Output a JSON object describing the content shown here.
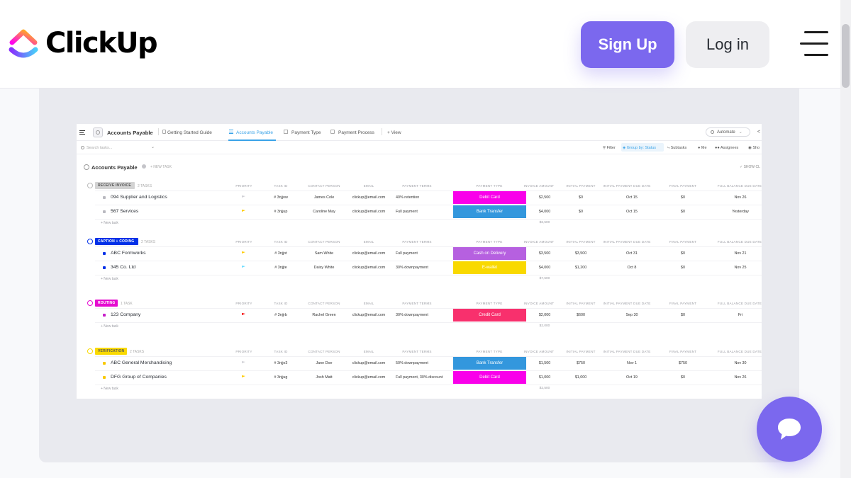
{
  "header": {
    "brand": "ClickUp",
    "signup_label": "Sign Up",
    "login_label": "Log in",
    "menu_icon": "hamburger-menu-icon"
  },
  "screenshot": {
    "list_title": "Accounts Payable",
    "tabs": [
      {
        "label": "Getting Started Guide",
        "active": false
      },
      {
        "label": "Accounts Payable",
        "active": true
      },
      {
        "label": "Payment Type",
        "active": false
      },
      {
        "label": "Payment Process",
        "active": false
      }
    ],
    "add_view": "+ View",
    "automate": "Automate",
    "search_placeholder": "Search tasks...",
    "toolbar": {
      "filter": "Filter",
      "group_by": "Group by: Status",
      "subtasks": "Subtasks",
      "me": "Me",
      "assignees": "Assignees",
      "show": "Sho"
    },
    "section_title": "Accounts Payable",
    "new_task_label": "+ NEW TASK",
    "show_closed": "SHOW CL",
    "columns": [
      "PRIORITY",
      "TASK ID",
      "CONTACT PERSON",
      "EMAIL",
      "PAYMENT TERMS",
      "PAYMENT TYPE",
      "INVOICE AMOUNT",
      "INITIAL PAYMENT",
      "INITIAL PAYMENT DUE DATE",
      "FINAL PAYMENT",
      "FULL BALANCE DUE DATE"
    ],
    "add_task": "+ New task",
    "groups": [
      {
        "status": "RECEIVE INVOICE",
        "count": "2 TASKS",
        "color": "#d3d3d3",
        "text_color": "#555555",
        "total": "$6,500",
        "tasks": [
          {
            "name": "094 Supplier and Logistics",
            "dot": "#b9b9c0",
            "flag": "#d0d0d6",
            "task_id": "# 3njjow",
            "contact": "James Cole",
            "email": "clickup@email.com",
            "terms": "40% retention",
            "type": "Debit Card",
            "type_color": "#f900ea",
            "invoice": "$2,500",
            "initial": "$0",
            "initial_due": "Oct 15",
            "final": "$0",
            "balance_due": "Nov 26"
          },
          {
            "name": "567 Services",
            "dot": "#b9b9c0",
            "flag": "#ffcc00",
            "task_id": "# 3njjup",
            "contact": "Caroline May",
            "email": "clickup@email.com",
            "terms": "Full payment",
            "type": "Bank Transfer",
            "type_color": "#3397dd",
            "invoice": "$4,000",
            "initial": "$0",
            "initial_due": "Oct 15",
            "final": "$0",
            "balance_due": "Yesterday"
          }
        ]
      },
      {
        "status": "CAPTION + CODING",
        "count": "2 TASKS",
        "color": "#0231e8",
        "text_color": "#ffffff",
        "total": "$7,500",
        "tasks": [
          {
            "name": "ABC Formworks",
            "dot": "#0231e8",
            "flag": "#ffcc00",
            "task_id": "# 3njjot",
            "contact": "Sam White",
            "email": "clickup@email.com",
            "terms": "Full payment",
            "type": "Cash on Delivery",
            "type_color": "#b660e0",
            "invoice": "$3,500",
            "initial": "$3,500",
            "initial_due": "Oct 31",
            "final": "$0",
            "balance_due": "Nov 21"
          },
          {
            "name": "345 Co. Ltd",
            "dot": "#0231e8",
            "flag": "#6fddff",
            "task_id": "# 3njjte",
            "contact": "Daisy White",
            "email": "clickup@email.com",
            "terms": "30% downpayment",
            "type": "E-wallet",
            "type_color": "#f9d900",
            "invoice": "$4,000",
            "initial": "$1,200",
            "initial_due": "Oct 8",
            "final": "$0",
            "balance_due": "Nov 25"
          }
        ]
      },
      {
        "status": "ROUTING",
        "count": "1 TASK",
        "color": "#e50bd0",
        "text_color": "#ffffff",
        "total": "$2,000",
        "tasks": [
          {
            "name": "123 Company",
            "dot": "#c71fc9",
            "flag": "#f50000",
            "task_id": "# 3njjrb",
            "contact": "Rachel Green",
            "email": "clickup@email.com",
            "terms": "30% downpayment",
            "type": "Credit Card",
            "type_color": "#f8306d",
            "invoice": "$2,000",
            "initial": "$600",
            "initial_due": "Sep 30",
            "final": "$0",
            "balance_due": "Fri"
          }
        ]
      },
      {
        "status": "VERIFICATION",
        "count": "2 TASKS",
        "color": "#f9d900",
        "text_color": "#555555",
        "total": "$2,500",
        "tasks": [
          {
            "name": "ABC General Merchandising",
            "dot": "#f9c900",
            "flag": "#d0d0d6",
            "task_id": "# 3njjo3",
            "contact": "Jane Doe",
            "email": "clickup@email.com",
            "terms": "50% downpayment",
            "type": "Bank Transfer",
            "type_color": "#3397dd",
            "invoice": "$1,500",
            "initial": "$750",
            "initial_due": "Nov 1",
            "final": "$750",
            "balance_due": "Nov 30"
          },
          {
            "name": "DFG Group of Companies",
            "dot": "#f9c900",
            "flag": "#ffcc00",
            "task_id": "# 3njjug",
            "contact": "Josh Matt",
            "email": "clickup@email.com",
            "terms": "Full payment, 30% discount",
            "type": "Debit Card",
            "type_color": "#f900ea",
            "invoice": "$1,000",
            "initial": "$1,000",
            "initial_due": "Oct 19",
            "final": "$0",
            "balance_due": "Nov 26"
          }
        ]
      }
    ]
  },
  "chat_icon": "chat-bubble-icon"
}
